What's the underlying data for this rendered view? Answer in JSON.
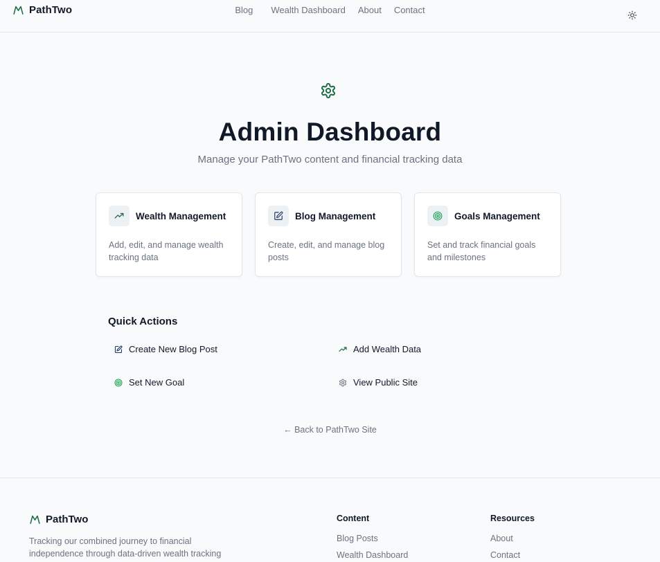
{
  "colors": {
    "accent": "#1f6b45",
    "background": "#f8fafb",
    "text": "#111827",
    "muted": "#6b7280"
  },
  "header": {
    "brand": "PathTwo",
    "nav": [
      "Blog",
      "Wealth Dashboard",
      "About",
      "Contact"
    ],
    "theme_toggle_icon": "sun-icon"
  },
  "hero": {
    "icon": "gear-icon",
    "title": "Admin Dashboard",
    "subtitle": "Manage your PathTwo content and financial tracking data"
  },
  "cards": [
    {
      "icon": "trending-up-icon",
      "title": "Wealth Management",
      "description": "Add, edit, and manage wealth tracking data"
    },
    {
      "icon": "edit-icon",
      "title": "Blog Management",
      "description": "Create, edit, and manage blog posts"
    },
    {
      "icon": "target-icon",
      "title": "Goals Management",
      "description": "Set and track financial goals and milestones"
    }
  ],
  "quick_actions": {
    "heading": "Quick Actions",
    "items": [
      {
        "icon": "edit-icon",
        "label": "Create New Blog Post"
      },
      {
        "icon": "trending-up-icon",
        "label": "Add Wealth Data"
      },
      {
        "icon": "target-icon",
        "label": "Set New Goal"
      },
      {
        "icon": "gear-icon",
        "label": "View Public Site"
      }
    ]
  },
  "back_link": "← Back to PathTwo Site",
  "footer": {
    "brand": "PathTwo",
    "tagline": "Tracking our combined journey to financial independence through data-driven wealth tracking",
    "columns": [
      {
        "title": "Content",
        "links": [
          "Blog Posts",
          "Wealth Dashboard"
        ]
      },
      {
        "title": "Resources",
        "links": [
          "About",
          "Contact"
        ]
      }
    ]
  }
}
